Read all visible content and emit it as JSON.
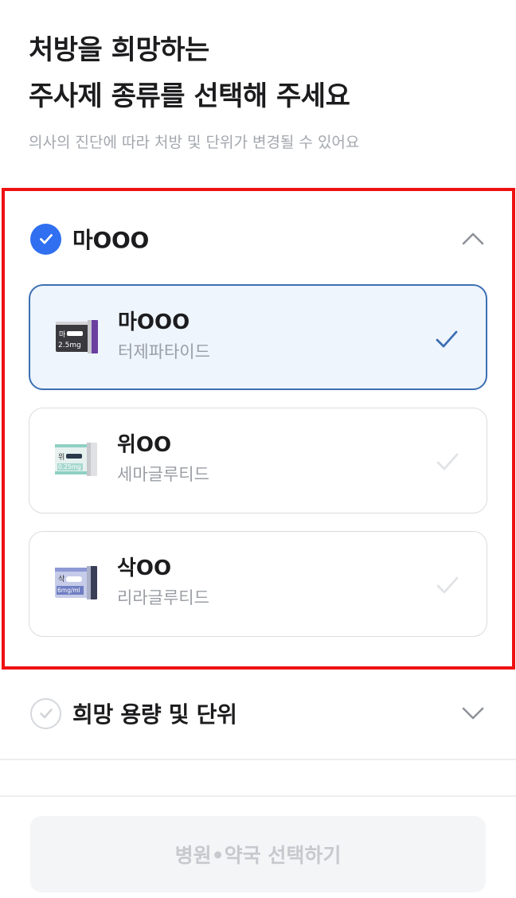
{
  "header": {
    "title_line1": "처방을 희망하는",
    "title_line2": "주사제 종류를 선택해 주세요",
    "subtitle": "의사의 진단에 따라 처방 및 단위가 변경될 수 있어요"
  },
  "injection_section": {
    "title": "마OOO",
    "state": "expanded",
    "options": [
      {
        "name": "마OOO",
        "ingredient": "터제파타이드",
        "selected": true,
        "thumb_label": "마",
        "thumb_dose": "2.5mg"
      },
      {
        "name": "위OO",
        "ingredient": "세마글루티드",
        "selected": false,
        "thumb_label": "위",
        "thumb_dose": "0.25mg"
      },
      {
        "name": "삭OO",
        "ingredient": "리라글루티드",
        "selected": false,
        "thumb_label": "삭",
        "thumb_dose": "6mg/ml"
      }
    ]
  },
  "dose_section": {
    "title": "희망 용량 및 단위",
    "state": "collapsed"
  },
  "cta": {
    "label": "병원•약국 선택하기",
    "enabled": false
  },
  "colors": {
    "accent": "#2f6ff0",
    "selected_border": "#3c6fb3",
    "selected_bg": "#eef5fc",
    "highlight_box": "#ee1111",
    "muted_text": "#9a9ea4"
  }
}
